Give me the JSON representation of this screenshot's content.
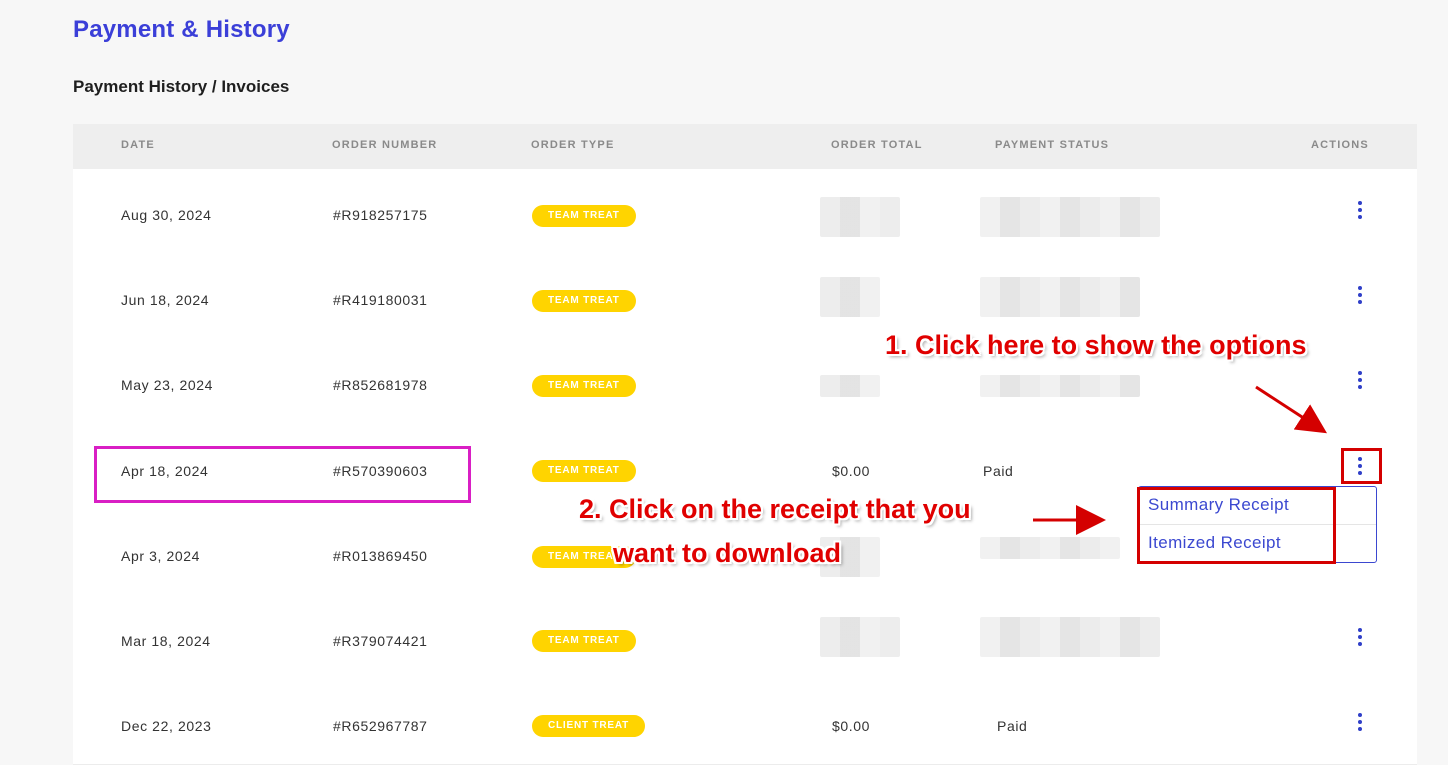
{
  "page": {
    "title": "Payment & History",
    "section_title": "Payment History / Invoices"
  },
  "table": {
    "headers": {
      "date": "DATE",
      "order_number": "ORDER NUMBER",
      "order_type": "ORDER TYPE",
      "order_total": "ORDER TOTAL",
      "payment_status": "PAYMENT STATUS",
      "actions": "ACTIONS"
    },
    "rows": [
      {
        "date": "Aug 30, 2024",
        "order_number": "#R918257175",
        "order_type": "TEAM TREAT",
        "order_total": "",
        "payment_status": ""
      },
      {
        "date": "Jun 18, 2024",
        "order_number": "#R419180031",
        "order_type": "TEAM TREAT",
        "order_total": "",
        "payment_status": ""
      },
      {
        "date": "May 23, 2024",
        "order_number": "#R852681978",
        "order_type": "TEAM TREAT",
        "order_total": "",
        "payment_status": ""
      },
      {
        "date": "Apr 18, 2024",
        "order_number": "#R570390603",
        "order_type": "TEAM TREAT",
        "order_total": "$0.00",
        "payment_status": "Paid"
      },
      {
        "date": "Apr 3, 2024",
        "order_number": "#R013869450",
        "order_type": "TEAM TREAT",
        "order_total": "",
        "payment_status": ""
      },
      {
        "date": "Mar 18, 2024",
        "order_number": "#R379074421",
        "order_type": "TEAM TREAT",
        "order_total": "",
        "payment_status": ""
      },
      {
        "date": "Dec 22, 2023",
        "order_number": "#R652967787",
        "order_type": "CLIENT TREAT",
        "order_total": "$0.00",
        "payment_status": "Paid"
      }
    ]
  },
  "dropdown": {
    "items": [
      "Summary Receipt",
      "Itemized Receipt"
    ]
  },
  "annotations": {
    "step1": "1. Click here to show the options",
    "step2_line1": "2. Click on the receipt that you",
    "step2_line2": "want to download"
  },
  "colors": {
    "accent": "#3b3fd8",
    "badge": "#ffd400",
    "annotation_red": "#e00000",
    "highlight_magenta": "#d91fc4"
  }
}
